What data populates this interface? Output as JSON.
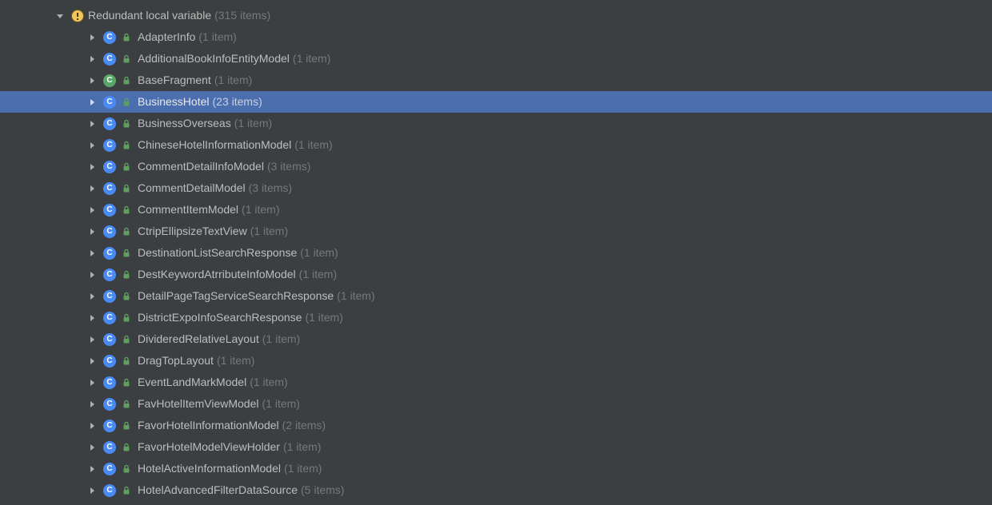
{
  "group": {
    "label": "Redundant local variable",
    "count": "(315 items)"
  },
  "items": [
    {
      "name": "AdapterInfo",
      "count": "(1 item)",
      "iconType": "class-blue",
      "selected": false
    },
    {
      "name": "AdditionalBookInfoEntityModel",
      "count": "(1 item)",
      "iconType": "class-blue",
      "selected": false
    },
    {
      "name": "BaseFragment",
      "count": "(1 item)",
      "iconType": "class-green",
      "selected": false
    },
    {
      "name": "BusinessHotel",
      "count": "(23 items)",
      "iconType": "class-blue",
      "selected": true
    },
    {
      "name": "BusinessOverseas",
      "count": "(1 item)",
      "iconType": "class-blue",
      "selected": false
    },
    {
      "name": "ChineseHotelInformationModel",
      "count": "(1 item)",
      "iconType": "class-blue",
      "selected": false
    },
    {
      "name": "CommentDetailInfoModel",
      "count": "(3 items)",
      "iconType": "class-blue",
      "selected": false
    },
    {
      "name": "CommentDetailModel",
      "count": "(3 items)",
      "iconType": "class-blue",
      "selected": false
    },
    {
      "name": "CommentItemModel",
      "count": "(1 item)",
      "iconType": "class-blue",
      "selected": false
    },
    {
      "name": "CtripEllipsizeTextView",
      "count": "(1 item)",
      "iconType": "class-blue",
      "selected": false
    },
    {
      "name": "DestinationListSearchResponse",
      "count": "(1 item)",
      "iconType": "class-blue",
      "selected": false
    },
    {
      "name": "DestKeywordAtrributeInfoModel",
      "count": "(1 item)",
      "iconType": "class-blue",
      "selected": false
    },
    {
      "name": "DetailPageTagServiceSearchResponse",
      "count": "(1 item)",
      "iconType": "class-blue",
      "selected": false
    },
    {
      "name": "DistrictExpoInfoSearchResponse",
      "count": "(1 item)",
      "iconType": "class-blue",
      "selected": false
    },
    {
      "name": "DivideredRelativeLayout",
      "count": "(1 item)",
      "iconType": "class-blue",
      "selected": false
    },
    {
      "name": "DragTopLayout",
      "count": "(1 item)",
      "iconType": "class-blue",
      "selected": false
    },
    {
      "name": "EventLandMarkModel",
      "count": "(1 item)",
      "iconType": "class-blue",
      "selected": false
    },
    {
      "name": "FavHotelItemViewModel",
      "count": "(1 item)",
      "iconType": "class-blue",
      "selected": false
    },
    {
      "name": "FavorHotelInformationModel",
      "count": "(2 items)",
      "iconType": "class-blue",
      "selected": false
    },
    {
      "name": "FavorHotelModelViewHolder",
      "count": "(1 item)",
      "iconType": "class-blue",
      "selected": false
    },
    {
      "name": "HotelActiveInformationModel",
      "count": "(1 item)",
      "iconType": "class-blue",
      "selected": false
    },
    {
      "name": "HotelAdvancedFilterDataSource",
      "count": "(5 items)",
      "iconType": "class-blue",
      "selected": false
    }
  ],
  "iconLetters": {
    "class-blue": "C",
    "class-green": "C"
  }
}
